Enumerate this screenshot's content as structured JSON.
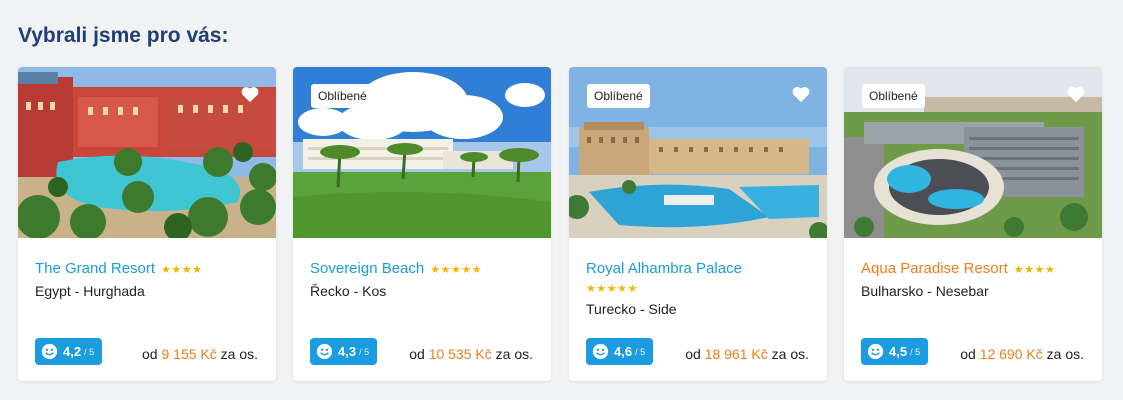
{
  "section": {
    "title": "Vybrali jsme pro vás:"
  },
  "colors": {
    "link_blue": "#1b9be0",
    "price_orange": "#ef7d1a",
    "star_gold": "#f5b400",
    "heading": "#1f3f73"
  },
  "cards": [
    {
      "badge": "",
      "name": "The Grand Resort",
      "stars": "★★★★",
      "location": "Egypt - Hurghada",
      "rating": "4,2",
      "rating_max": "/ 5",
      "price_prefix": "od",
      "price": "9 155 Kč",
      "price_suffix": "za os.",
      "icons": [
        "heart-icon",
        "smile-icon"
      ]
    },
    {
      "badge": "Oblíbené",
      "name": "Sovereign Beach",
      "stars": "★★★★★",
      "location": "Řecko - Kos",
      "rating": "4,3",
      "rating_max": "/ 5",
      "price_prefix": "od",
      "price": "10 535 Kč",
      "price_suffix": "za os.",
      "icons": [
        "smile-icon"
      ]
    },
    {
      "badge": "Oblíbené",
      "name": "Royal Alhambra Palace",
      "stars": "★★★★★",
      "location": "Turecko - Side",
      "rating": "4,6",
      "rating_max": "/ 5",
      "price_prefix": "od",
      "price": "18 961 Kč",
      "price_suffix": "za os.",
      "icons": [
        "heart-icon",
        "smile-icon"
      ]
    },
    {
      "badge": "Oblíbené",
      "name": "Aqua Paradise Resort",
      "stars": "★★★★",
      "location": "Bulharsko - Nesebar",
      "rating": "4,5",
      "rating_max": "/ 5",
      "price_prefix": "od",
      "price": "12 690 Kč",
      "price_suffix": "za os.",
      "icons": [
        "heart-icon",
        "smile-icon"
      ]
    }
  ]
}
